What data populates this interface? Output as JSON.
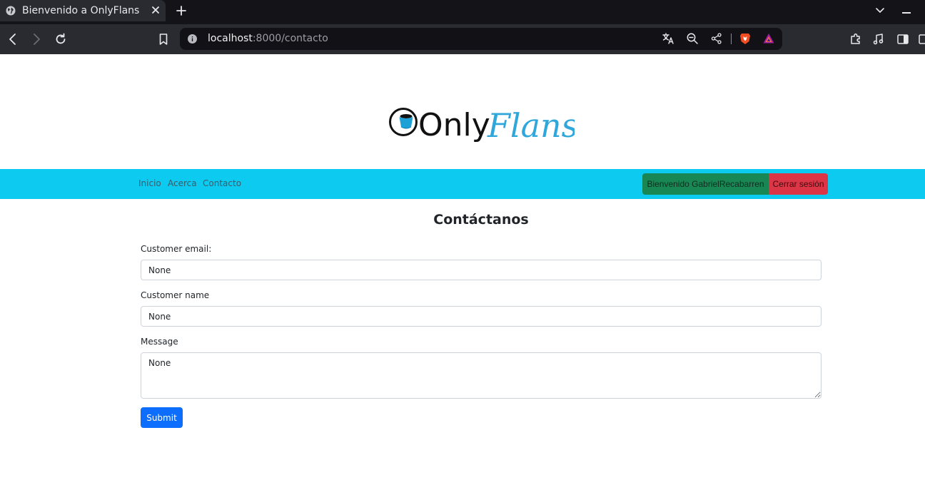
{
  "browser": {
    "tab_title": "Bienvenido a OnlyFlans",
    "url_host": "localhost",
    "url_path": ":8000/contacto"
  },
  "site": {
    "logo_text_dark": "Only",
    "logo_text_light": "Flans",
    "nav": {
      "home": "Inicio",
      "about": "Acerca",
      "contact": "Contacto"
    },
    "welcome_label": "Bienvenido GabrielRecabarren",
    "logout_label": "Cerrar sesión"
  },
  "form": {
    "title": "Contáctanos",
    "email_label": "Customer email:",
    "email_value": "None",
    "name_label": "Customer name",
    "name_value": "None",
    "message_label": "Message",
    "message_value": "None",
    "submit_label": "Submit"
  },
  "colors": {
    "navbar": "#0dcaf0",
    "welcome": "#198754",
    "logout": "#dc3545",
    "submit": "#0d6efd"
  }
}
